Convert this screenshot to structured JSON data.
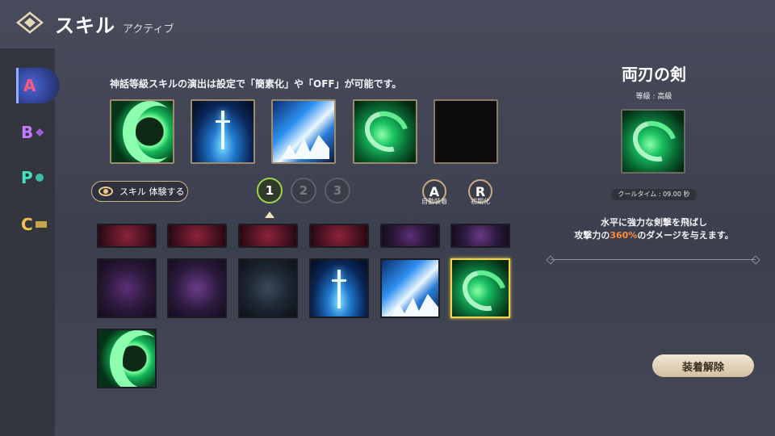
{
  "header": {
    "title": "スキル",
    "subtitle": "アクティブ",
    "back_icon": "diamond-back-icon"
  },
  "sidebar": {
    "tabs": [
      {
        "label": "A",
        "active": true
      },
      {
        "label": "B"
      },
      {
        "label": "P"
      },
      {
        "label": "C"
      }
    ]
  },
  "main": {
    "notice": "神話等級スキルの演出は設定で「簡素化」や「OFF」が可能です。",
    "equipped_slots": [
      "green-crescent-icon",
      "blue-sword-icon",
      "blue-shard-icon",
      "green-swirl-icon",
      "empty-slot"
    ],
    "try_button": "スキル 体験する",
    "pages": [
      "1",
      "2",
      "3"
    ],
    "active_page": "1",
    "auto_equip": {
      "label": "A",
      "caption": "自動装着"
    },
    "reset": {
      "label": "R",
      "caption": "初期化"
    }
  },
  "detail": {
    "skill_name": "両刃の剣",
    "grade": "等級 : 高級",
    "cooltime": "クールタイム : 09.00 秒",
    "desc_line1": "水平に強力な剣撃を飛ばし",
    "desc_pre": "攻撃力の",
    "desc_value": "360%",
    "desc_post": "のダメージを与えます。",
    "unequip_button": "装着解除"
  },
  "colors": {
    "accent_gold": "#f3d34a",
    "frame": "#a08a6c",
    "highlight_orange": "#ff8a3a"
  }
}
